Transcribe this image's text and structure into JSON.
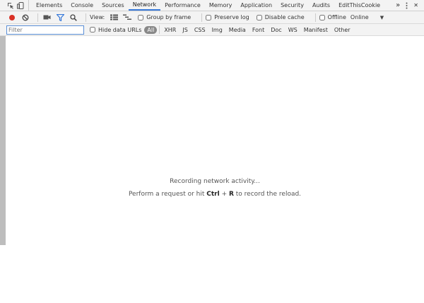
{
  "tabs": [
    {
      "label": "Elements"
    },
    {
      "label": "Console"
    },
    {
      "label": "Sources"
    },
    {
      "label": "Network",
      "active": true
    },
    {
      "label": "Performance"
    },
    {
      "label": "Memory"
    },
    {
      "label": "Application"
    },
    {
      "label": "Security"
    },
    {
      "label": "Audits"
    },
    {
      "label": "EditThisCookie"
    }
  ],
  "tab_overflow": "»",
  "close_glyph": "✕",
  "toolbar": {
    "view_label": "View:",
    "group_by_frame": "Group by frame",
    "preserve_log": "Preserve log",
    "disable_cache": "Disable cache",
    "offline": "Offline",
    "throttle_value": "Online",
    "record_color": "#d93025",
    "filter_color": "#3879d9"
  },
  "filterbar": {
    "placeholder": "Filter",
    "hide_data_urls": "Hide data URLs",
    "types": [
      "All",
      "XHR",
      "JS",
      "CSS",
      "Img",
      "Media",
      "Font",
      "Doc",
      "WS",
      "Manifest",
      "Other"
    ]
  },
  "main": {
    "recording": "Recording network activity...",
    "hint_prefix": "Perform a request or hit ",
    "hint_key1": "Ctrl",
    "hint_plus": " + ",
    "hint_key2": "R",
    "hint_suffix": " to record the reload."
  }
}
